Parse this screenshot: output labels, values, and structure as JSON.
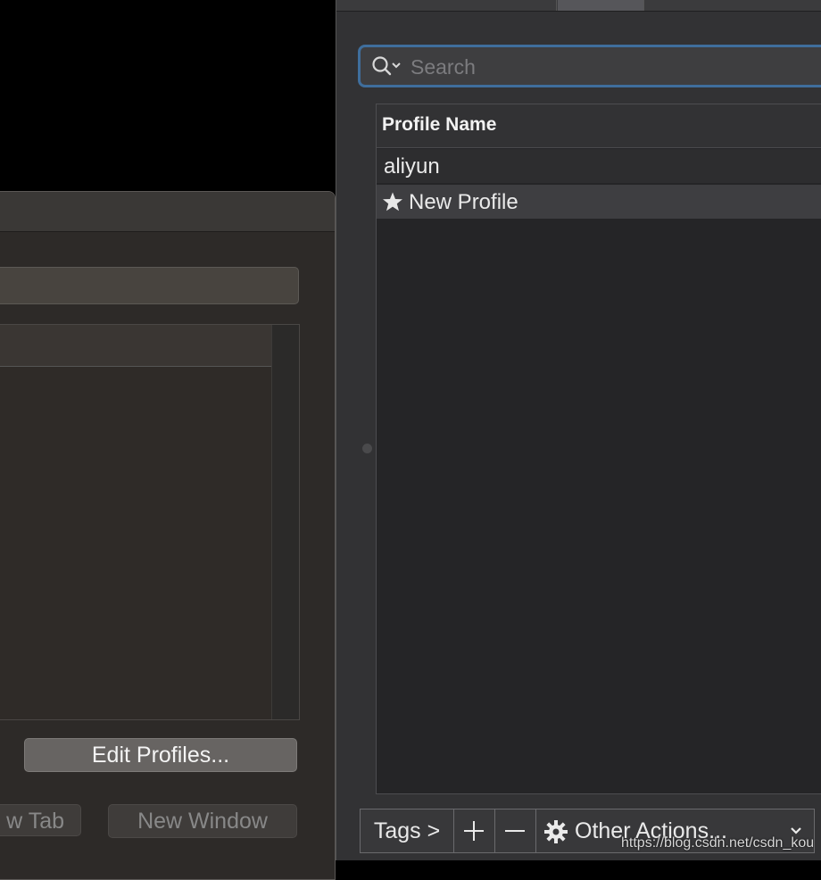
{
  "search": {
    "placeholder": "Search"
  },
  "profile_table": {
    "header": "Profile Name",
    "rows": [
      {
        "name": "aliyun",
        "is_default": false
      },
      {
        "name": "New Profile",
        "is_default": true,
        "icon": "star-icon"
      }
    ]
  },
  "bottom_bar": {
    "tags": "Tags >",
    "add": "+",
    "remove": "—",
    "other_actions": "Other Actions...",
    "other_actions_icon": "gear-icon"
  },
  "left_window": {
    "edit_profiles": "Edit Profiles...",
    "new_tab": "w Tab",
    "new_window": "New Window"
  },
  "watermark": "https://blog.csdn.net/csdn_kou",
  "colors": {
    "focus_ring": "#3f6e9c",
    "selected_row": "#3e3e41"
  }
}
